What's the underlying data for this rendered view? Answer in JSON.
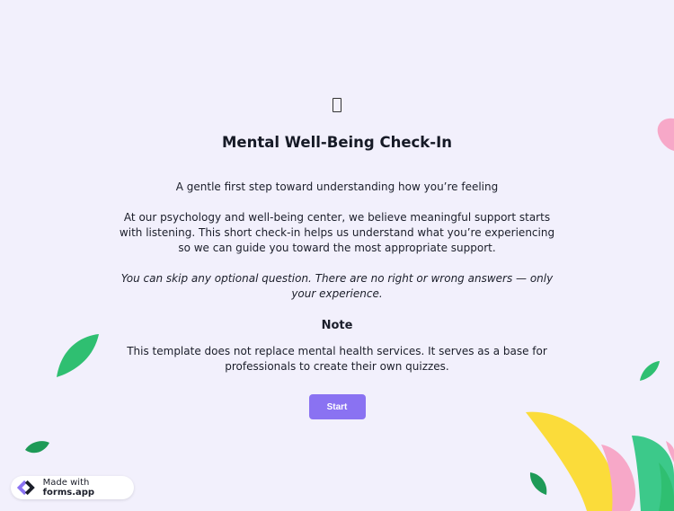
{
  "icons": {
    "top": "image-placeholder-icon",
    "badge": "forms-app-logo"
  },
  "form": {
    "title": "Mental Well-Being Check-In",
    "subtitle": "A gentle first step toward understanding how you’re feeling",
    "intro": "At our psychology and well-being center, we believe meaningful support starts with listening. This short check-in helps us understand what you’re experiencing so we can guide you toward the most appropriate support.",
    "optional_note": "You can skip any optional question. There are no right or wrong answers — only your experience.",
    "note_heading": "Note",
    "note_body": "This template does not replace mental health services. It serves as a base for professionals to create their own quizzes.",
    "start_label": "Start"
  },
  "badge": {
    "prefix": "Made with ",
    "brand": "forms.app"
  },
  "colors": {
    "background": "#f2f0fc",
    "accent": "#8a72f2",
    "leaf_green": "#2fbf71",
    "leaf_dark_green": "#1e9a57",
    "petal_pink": "#f7a8c8",
    "petal_yellow": "#fbdc3a"
  }
}
